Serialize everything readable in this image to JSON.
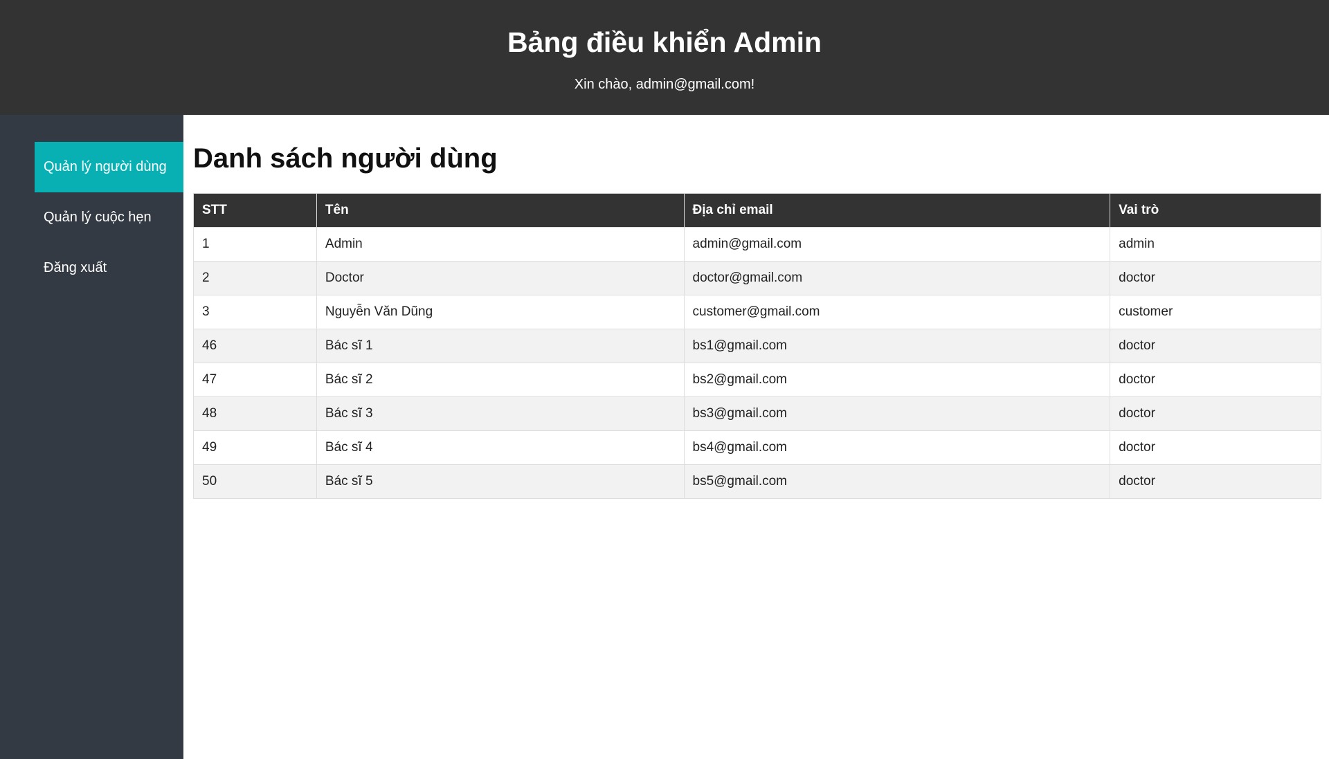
{
  "header": {
    "title": "Bảng điều khiển Admin",
    "greeting": "Xin chào, admin@gmail.com!"
  },
  "sidebar": {
    "items": [
      {
        "label": "Quản lý người dùng",
        "active": true
      },
      {
        "label": "Quản lý cuộc hẹn",
        "active": false
      },
      {
        "label": "Đăng xuất",
        "active": false
      }
    ]
  },
  "main": {
    "title": "Danh sách người dùng",
    "table": {
      "columns": [
        "STT",
        "Tên",
        "Địa chỉ email",
        "Vai trò"
      ],
      "rows": [
        [
          "1",
          "Admin",
          "admin@gmail.com",
          "admin"
        ],
        [
          "2",
          "Doctor",
          "doctor@gmail.com",
          "doctor"
        ],
        [
          "3",
          "Nguyễn Văn Dũng",
          "customer@gmail.com",
          "customer"
        ],
        [
          "46",
          "Bác sĩ 1",
          "bs1@gmail.com",
          "doctor"
        ],
        [
          "47",
          "Bác sĩ 2",
          "bs2@gmail.com",
          "doctor"
        ],
        [
          "48",
          "Bác sĩ 3",
          "bs3@gmail.com",
          "doctor"
        ],
        [
          "49",
          "Bác sĩ 4",
          "bs4@gmail.com",
          "doctor"
        ],
        [
          "50",
          "Bác sĩ 5",
          "bs5@gmail.com",
          "doctor"
        ]
      ]
    }
  },
  "colors": {
    "header_bg": "#333333",
    "sidebar_bg": "#343a44",
    "accent": "#08b0b4",
    "row_alt": "#f2f2f2"
  }
}
